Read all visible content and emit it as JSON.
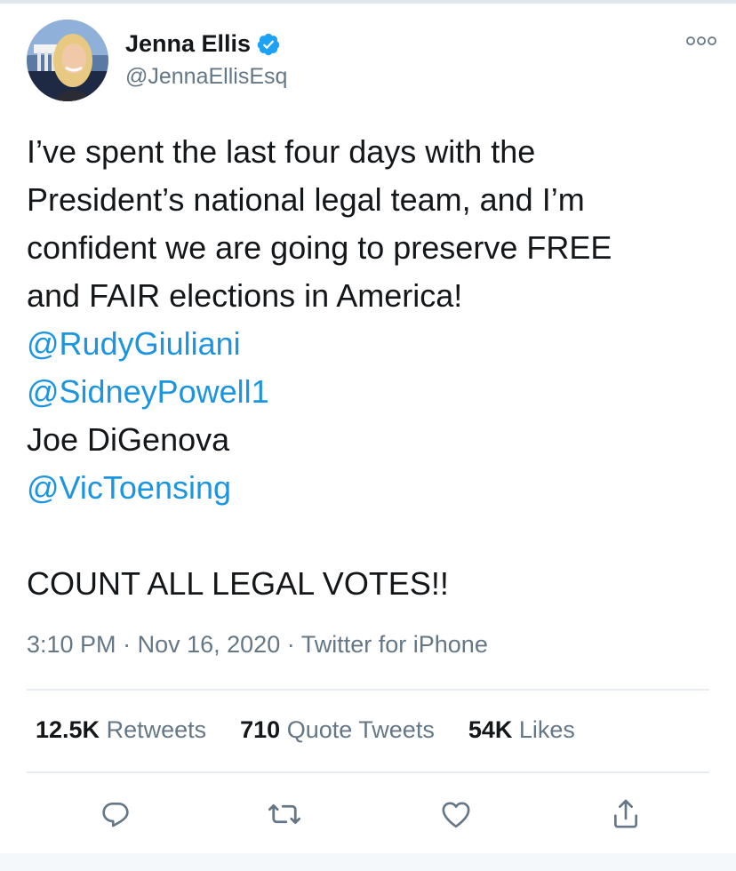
{
  "user": {
    "display_name": "Jenna Ellis",
    "handle": "@JennaEllisEsq",
    "verified": true
  },
  "tweet": {
    "lines": [
      {
        "text": "I’ve spent the last four days with the",
        "type": "text"
      },
      {
        "text": "President’s national legal team, and I’m",
        "type": "text"
      },
      {
        "text": "confident we are going to preserve FREE",
        "type": "text"
      },
      {
        "text": "and FAIR elections in America!",
        "type": "text"
      },
      {
        "text": "@RudyGiuliani",
        "type": "mention"
      },
      {
        "text": "@SidneyPowell1",
        "type": "mention"
      },
      {
        "text": "Joe DiGenova",
        "type": "text"
      },
      {
        "text": "@VicToensing",
        "type": "mention"
      },
      {
        "text": "",
        "type": "blank"
      },
      {
        "text": "COUNT ALL LEGAL VOTES!!",
        "type": "text"
      }
    ],
    "time": "3:10 PM",
    "date": "Nov 16, 2020",
    "source": "Twitter for iPhone",
    "dot": "·"
  },
  "stats": {
    "retweets_count": "12.5K",
    "retweets_label": "Retweets",
    "quotes_count": "710",
    "quotes_label": "Quote Tweets",
    "likes_count": "54K",
    "likes_label": "Likes"
  },
  "icons": {
    "reply": "reply-icon",
    "retweet": "retweet-icon",
    "like": "heart-icon",
    "share": "share-icon",
    "more": "more-icon",
    "verified": "verified-badge-icon"
  },
  "colors": {
    "mention": "#1b95e0",
    "verified": "#1da1f2",
    "secondary": "#657786",
    "primary": "#14171a"
  }
}
